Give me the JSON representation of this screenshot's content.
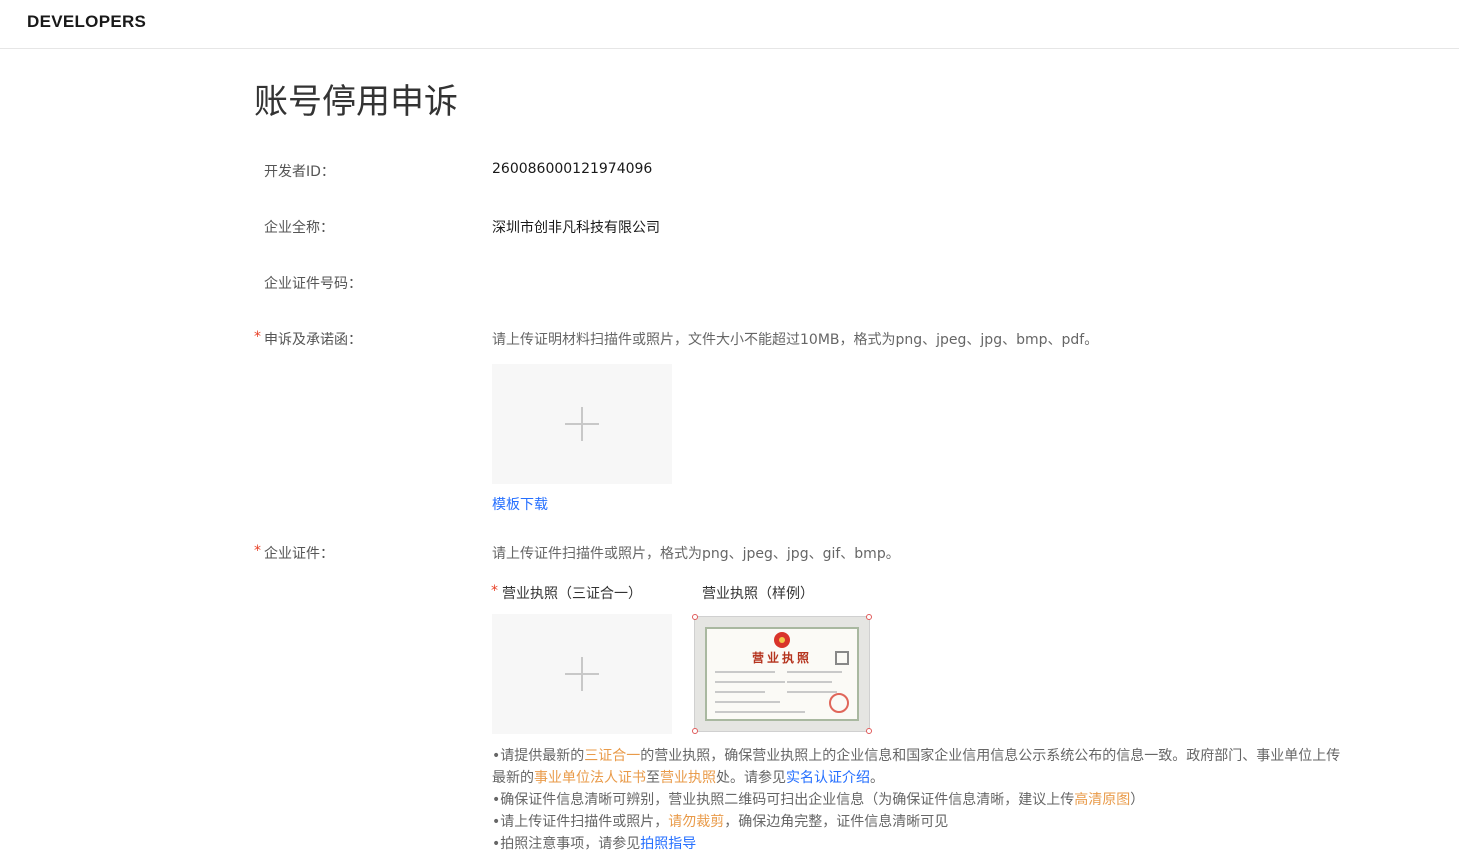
{
  "header": {
    "brand": "DEVELOPERS"
  },
  "page": {
    "title": "账号停用申诉"
  },
  "fields": {
    "developer_id": {
      "label": "开发者ID：",
      "value": "260086000121974096"
    },
    "company_name": {
      "label": "企业全称：",
      "value": "深圳市创非凡科技有限公司"
    },
    "company_cert_no": {
      "label": "企业证件号码：",
      "value": ""
    }
  },
  "appeal": {
    "required_mark": "*",
    "label": "申诉及承诺函：",
    "hint": "请上传证明材料扫描件或照片，文件大小不能超过10MB，格式为png、jpeg、jpg、bmp、pdf。",
    "template_link": "模板下载"
  },
  "company_cert": {
    "required_mark": "*",
    "label": "企业证件：",
    "hint": "请上传证件扫描件或照片，格式为png、jpeg、jpg、gif、bmp。",
    "license_required_mark": "*",
    "license_label": "营业执照（三证合一）",
    "sample_label": "营业执照（样例）",
    "sample_image_title": "营业执照"
  },
  "notes": {
    "n1_a": "•请提供最新的",
    "n1_link1": "三证合一",
    "n1_b": "的营业执照，确保营业执照上的企业信息和国家企业信用信息公示系统公布的信息一致。政府部门、事业单位上传最新的",
    "n1_link2": "事业单位法人证书",
    "n1_c": "至",
    "n1_link3": "营业执照",
    "n1_d": "处。请参见",
    "n1_link4": "实名认证介绍",
    "n1_e": "。",
    "n2_a": "•确保证件信息清晰可辨别，营业执照二维码可扫出企业信息（为确保证件信息清晰，建议上传",
    "n2_link": "高清原图",
    "n2_b": "）",
    "n3_a": "•请上传证件扫描件或照片，",
    "n3_link": "请勿裁剪",
    "n3_b": "，确保边角完整，证件信息清晰可见",
    "n4_a": "•拍照注意事项，请参见",
    "n4_link": "拍照指导"
  }
}
